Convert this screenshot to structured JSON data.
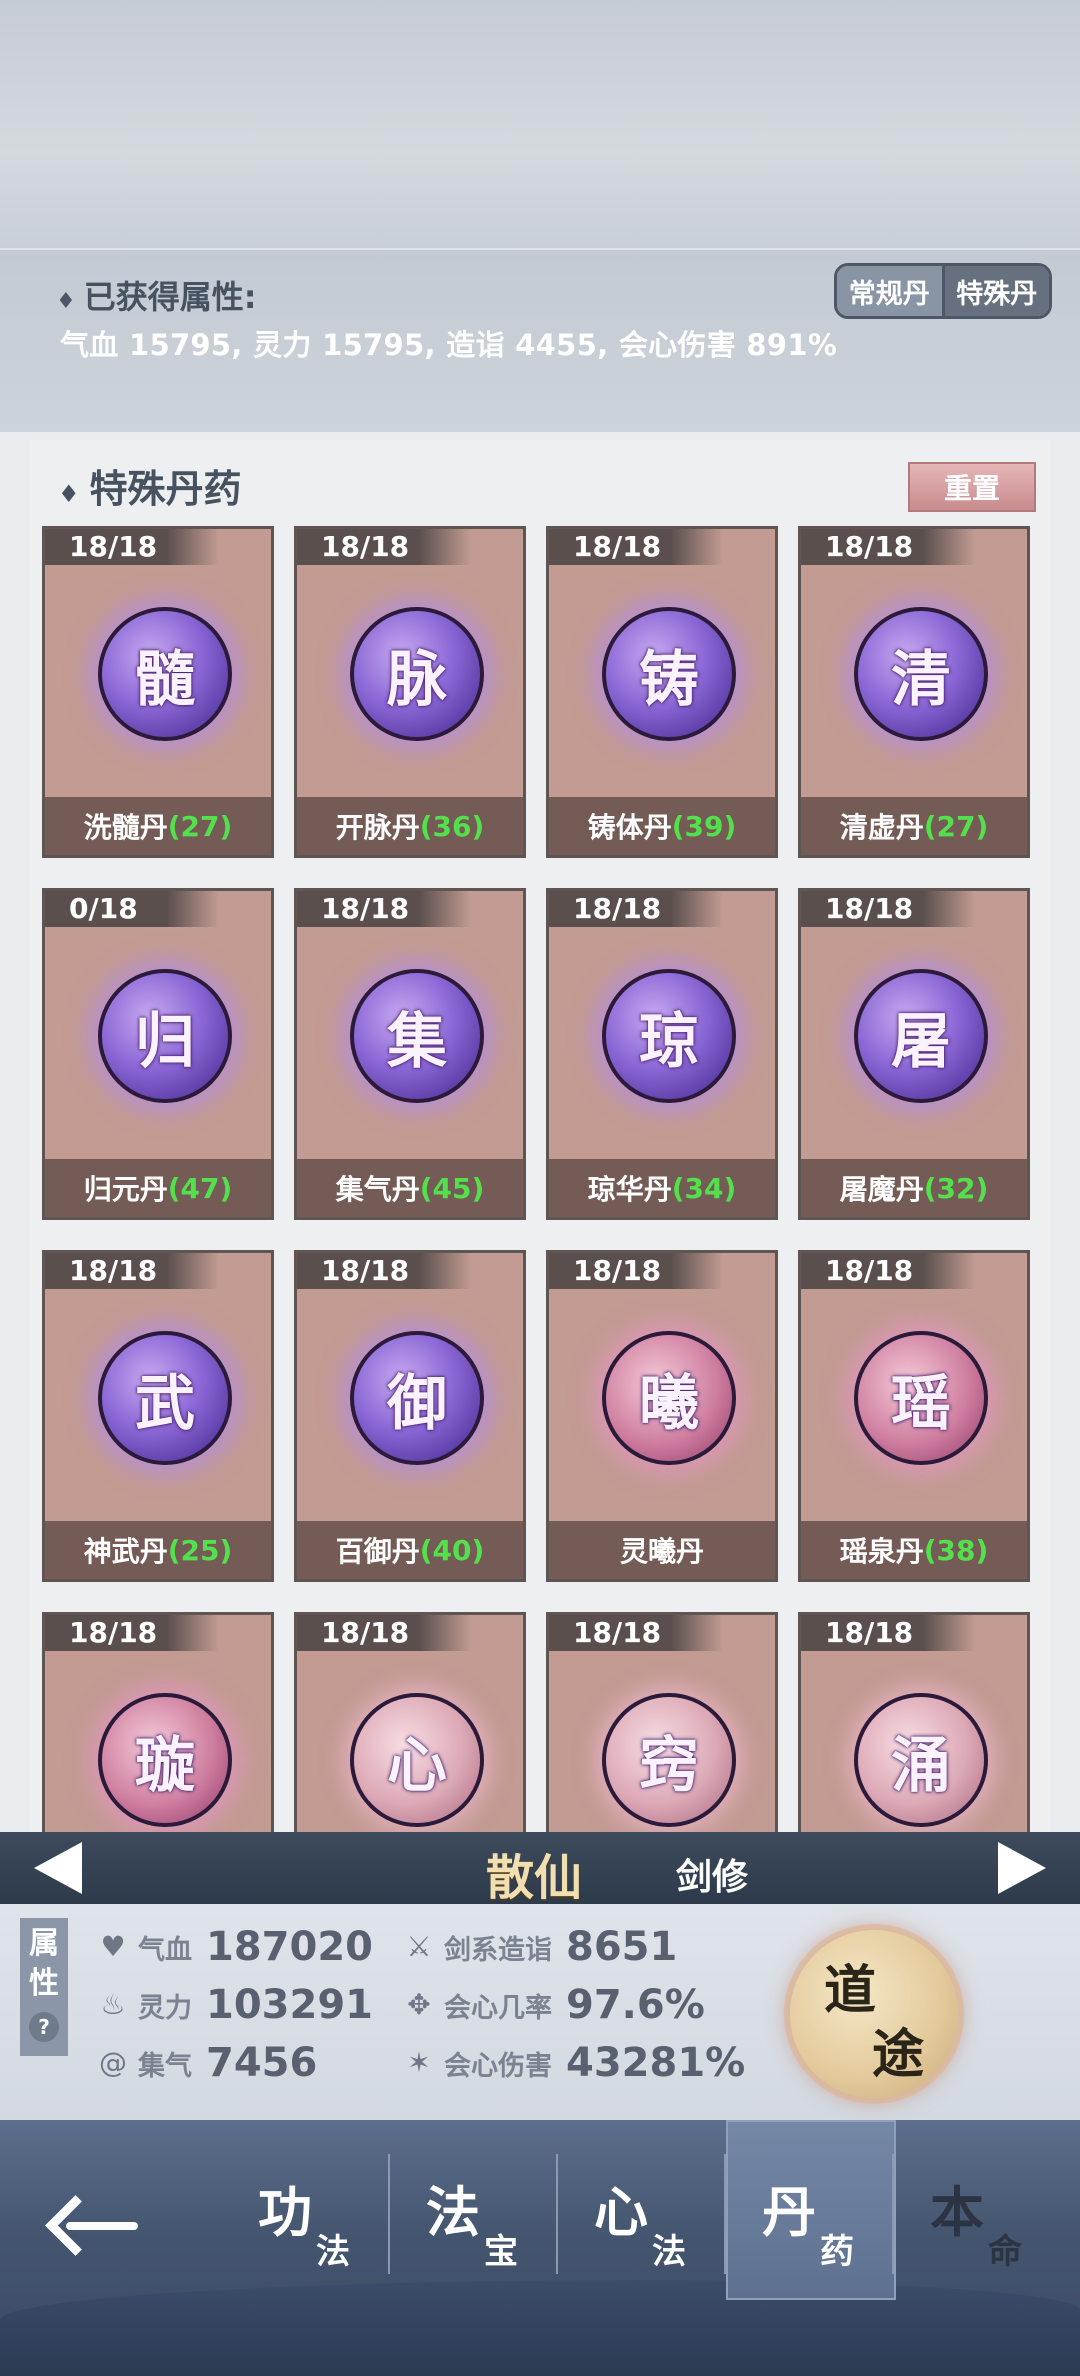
{
  "attributes_panel": {
    "title": "已获得属性:",
    "values": "气血 15795, 灵力 15795, 造诣 4455, 会心伤害 891%",
    "toggle": {
      "normal": "常规丹",
      "special": "特殊丹",
      "active": "special"
    }
  },
  "pill_list": {
    "title": "特殊丹药",
    "reset_label": "重置",
    "items": [
      {
        "count": "18/18",
        "glyph": "髓",
        "name": "洗髓丹",
        "num": "(27)",
        "orb": "purple"
      },
      {
        "count": "18/18",
        "glyph": "脉",
        "name": "开脉丹",
        "num": "(36)",
        "orb": "purple"
      },
      {
        "count": "18/18",
        "glyph": "铸",
        "name": "铸体丹",
        "num": "(39)",
        "orb": "purple"
      },
      {
        "count": "18/18",
        "glyph": "清",
        "name": "清虚丹",
        "num": "(27)",
        "orb": "purple"
      },
      {
        "count": "0/18",
        "glyph": "归",
        "name": "归元丹",
        "num": "(47)",
        "orb": "purple"
      },
      {
        "count": "18/18",
        "glyph": "集",
        "name": "集气丹",
        "num": "(45)",
        "orb": "purple"
      },
      {
        "count": "18/18",
        "glyph": "琼",
        "name": "琼华丹",
        "num": "(34)",
        "orb": "purple"
      },
      {
        "count": "18/18",
        "glyph": "屠",
        "name": "屠魔丹",
        "num": "(32)",
        "orb": "purple"
      },
      {
        "count": "18/18",
        "glyph": "武",
        "name": "神武丹",
        "num": "(25)",
        "orb": "purple"
      },
      {
        "count": "18/18",
        "glyph": "御",
        "name": "百御丹",
        "num": "(40)",
        "orb": "purple"
      },
      {
        "count": "18/18",
        "glyph": "曦",
        "name": "灵曦丹",
        "num": "",
        "orb": "pink"
      },
      {
        "count": "18/18",
        "glyph": "瑶",
        "name": "瑶泉丹",
        "num": "(38)",
        "orb": "pink"
      },
      {
        "count": "18/18",
        "glyph": "璇",
        "name": "",
        "num": "",
        "orb": "pink"
      },
      {
        "count": "18/18",
        "glyph": "心",
        "name": "",
        "num": "",
        "orb": "light"
      },
      {
        "count": "18/18",
        "glyph": "窍",
        "name": "",
        "num": "",
        "orb": "light"
      },
      {
        "count": "18/18",
        "glyph": "涌",
        "name": "",
        "num": "",
        "orb": "light"
      }
    ]
  },
  "character": {
    "realm": "散仙",
    "class": "剑修"
  },
  "stats": {
    "tab_label": "属性",
    "help": "?",
    "hp_label": "气血",
    "hp_value": "187020",
    "mana_label": "灵力",
    "mana_value": "103291",
    "qi_label": "集气",
    "qi_value": "7456",
    "sword_label": "剑系造诣",
    "sword_value": "8651",
    "crit_rate_label": "会心几率",
    "crit_rate_value": "97.6%",
    "crit_dmg_label": "会心伤害",
    "crit_dmg_value": "43281%",
    "emblem_1": "道",
    "emblem_2": "途"
  },
  "nav": {
    "tabs": [
      {
        "big": "功",
        "small": "法"
      },
      {
        "big": "法",
        "small": "宝"
      },
      {
        "big": "心",
        "small": "法"
      },
      {
        "big": "丹",
        "small": "药"
      },
      {
        "big": "本",
        "small": "命"
      }
    ],
    "active_index": 3
  },
  "colors": {
    "accent_green": "#54e04c",
    "card_bg": "#c29b92",
    "nav_bg": "#44556f"
  }
}
